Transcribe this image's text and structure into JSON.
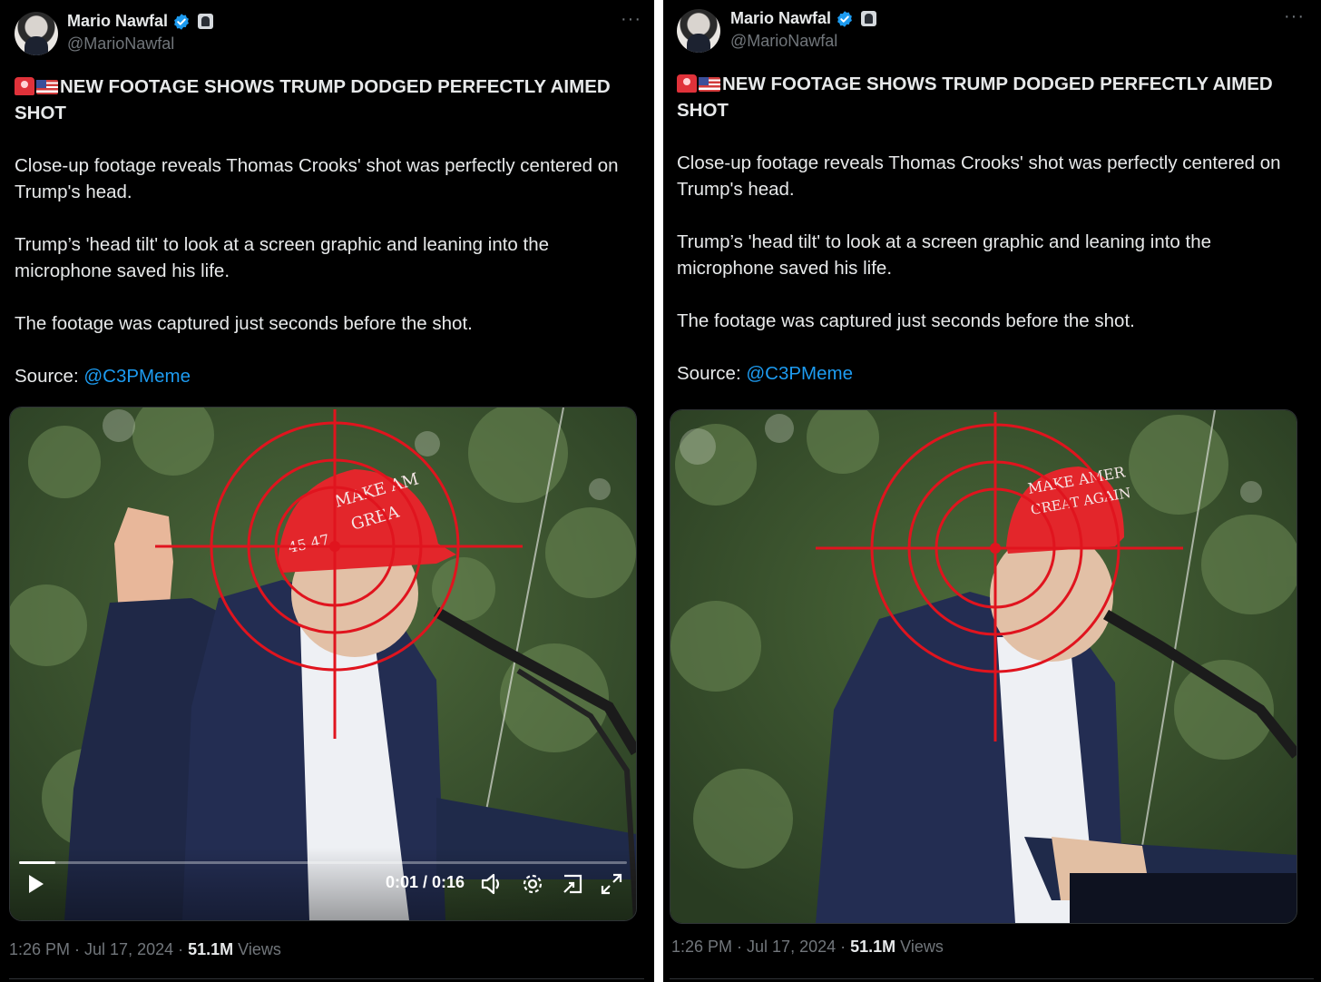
{
  "tweets": [
    {
      "author": {
        "name": "Mario Nawfal",
        "handle": "@MarioNawfal"
      },
      "headline": "NEW FOOTAGE SHOWS TRUMP DODGED PERFECTLY AIMED SHOT",
      "paragraphs": [
        "Close-up footage reveals Thomas Crooks' shot was perfectly centered on Trump's head.",
        "Trump’s 'head tilt' to look at a screen graphic and leaning into the microphone saved his life.",
        "The footage was captured just seconds before the shot."
      ],
      "source_label": "Source:",
      "source_link": "@C3PMeme",
      "video": {
        "time": "0:01 / 0:16",
        "progress": 0.06,
        "hat_text_1": "MAKE AM",
        "hat_text_2": "GREA",
        "hat_side": "45 47"
      },
      "timestamp": "1:26 PM · Jul 17, 2024 · ",
      "views_count": "51.1M",
      "views_label": " Views"
    },
    {
      "author": {
        "name": "Mario Nawfal",
        "handle": "@MarioNawfal"
      },
      "headline": "NEW FOOTAGE SHOWS TRUMP DODGED PERFECTLY AIMED SHOT",
      "paragraphs": [
        "Close-up footage reveals Thomas Crooks' shot was perfectly centered on Trump's head.",
        "Trump’s 'head tilt' to look at a screen graphic and leaning into the microphone saved his life.",
        "The footage was captured just seconds before the shot."
      ],
      "source_label": "Source:",
      "source_link": "@C3PMeme",
      "video": {
        "hat_text_1": "MAKE AMER",
        "hat_text_2": "GREAT AGAIN"
      },
      "timestamp": "1:26 PM · Jul 17, 2024 · ",
      "views_count": "51.1M",
      "views_label": " Views"
    }
  ],
  "colors": {
    "background": "#000000",
    "text": "#e7e9ea",
    "muted": "#71767b",
    "link": "#1d9bf0",
    "verified": "#1d9bf0",
    "crosshair": "#e0141e"
  },
  "icons": [
    "verified-badge-icon",
    "affiliate-badge-icon",
    "more-icon",
    "siren-icon",
    "us-flag-icon",
    "play-icon",
    "volume-icon",
    "settings-icon",
    "pip-icon",
    "fullscreen-icon"
  ]
}
